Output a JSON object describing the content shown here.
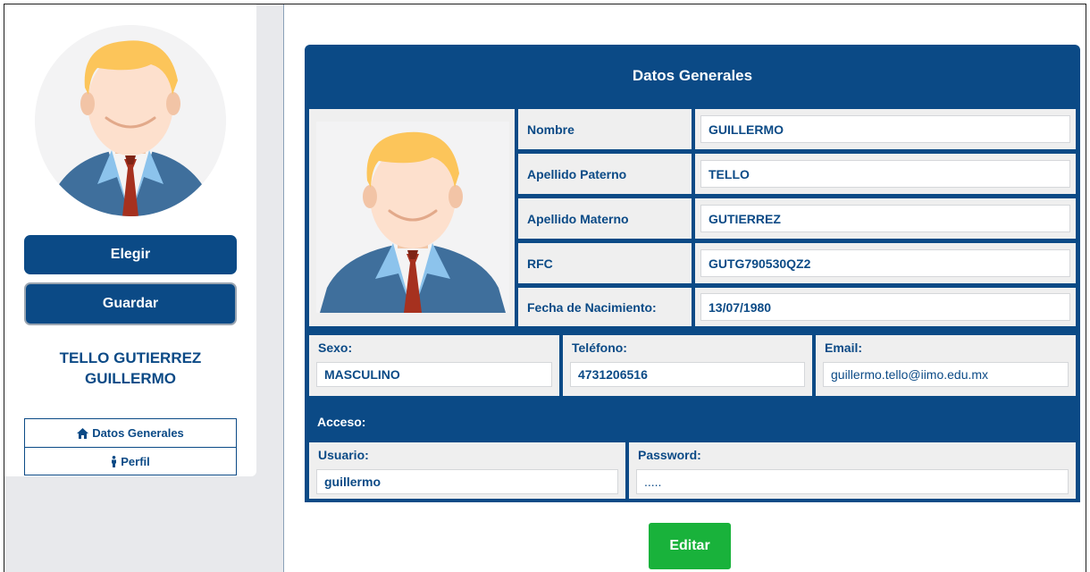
{
  "colors": {
    "primary": "#0b4a86",
    "success": "#19b23b",
    "cell_bg": "#efefef",
    "sidebar_bg": "#e8e9ec"
  },
  "sidebar": {
    "avatar_icon": "person-avatar-icon",
    "choose_label": "Elegir",
    "save_label": "Guardar",
    "user_full_name": "TELLO GUTIERREZ GUILLERMO",
    "nav": [
      {
        "icon": "home-icon",
        "label": "Datos Generales"
      },
      {
        "icon": "person-icon",
        "label": "Perfil"
      }
    ]
  },
  "panel": {
    "title": "Datos Generales",
    "fields": [
      {
        "label": "Nombre",
        "value": "GUILLERMO"
      },
      {
        "label": "Apellido Paterno",
        "value": "TELLO"
      },
      {
        "label": "Apellido Materno",
        "value": "GUTIERREZ"
      },
      {
        "label": "RFC",
        "value": "GUTG790530QZ2"
      },
      {
        "label": "Fecha de Nacimiento:",
        "value": "13/07/1980"
      }
    ],
    "sexo": {
      "label": "Sexo:",
      "value": "MASCULINO"
    },
    "telefono": {
      "label": "Teléfono:",
      "value": "4731206516"
    },
    "email": {
      "label": "Email:",
      "value": "guillermo.tello@iimo.edu.mx"
    },
    "access": {
      "label": "Acceso:",
      "usuario": {
        "label": "Usuario:",
        "value": "guillermo"
      },
      "password": {
        "label": "Password:",
        "value": "....."
      }
    }
  },
  "edit_label": "Editar"
}
